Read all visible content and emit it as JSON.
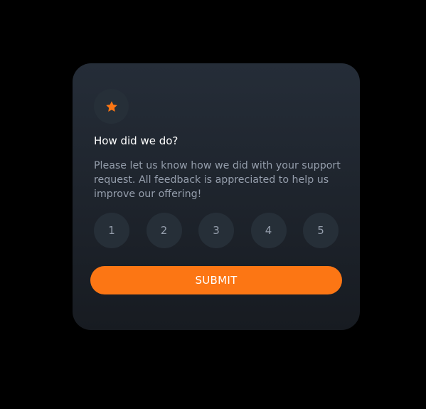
{
  "card": {
    "icon": "star-icon",
    "title": "How did we do?",
    "description": "Please let us know how we did with your support request. All feedback is appreciated to help us improve our offering!",
    "ratings": [
      "1",
      "2",
      "3",
      "4",
      "5"
    ],
    "submit_label": "SUBMIT"
  },
  "colors": {
    "background": "#000000",
    "card_top": "#252d38",
    "card_bottom": "#171b21",
    "accent": "#fc7614",
    "muted_text": "#959eac",
    "circle": "#262f38",
    "title_text": "#ffffff"
  }
}
